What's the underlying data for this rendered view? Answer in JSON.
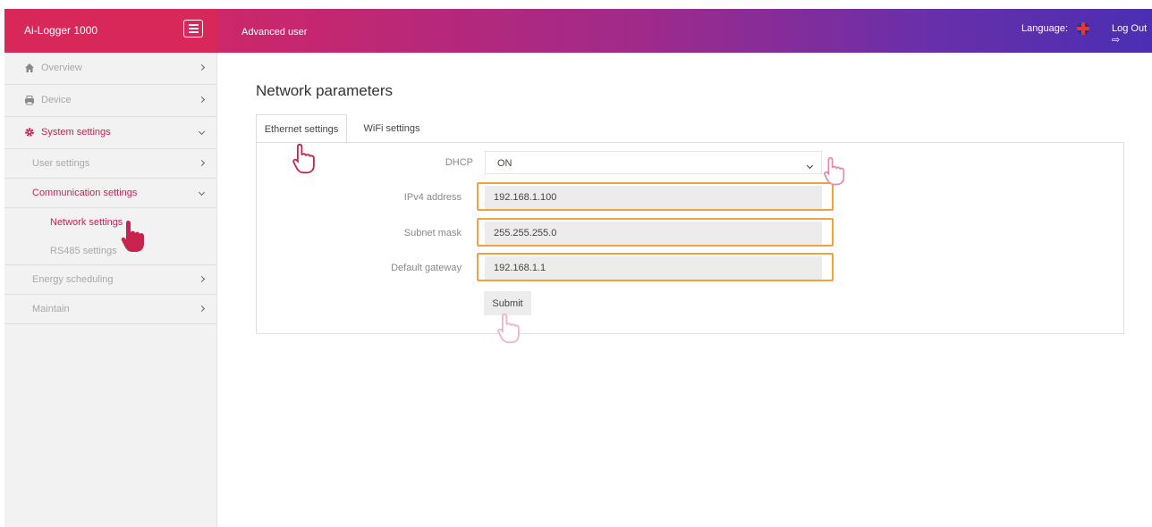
{
  "header": {
    "brand": "Ai-Logger 1000",
    "user_role": "Advanced user",
    "language_label": "Language:",
    "logout": "Log Out"
  },
  "sidebar": {
    "items": [
      {
        "label": "Overview",
        "icon": "home-icon"
      },
      {
        "label": "Device",
        "icon": "printer-icon"
      },
      {
        "label": "System settings",
        "icon": "gear-icon"
      }
    ],
    "system_children": [
      {
        "label": "User settings"
      },
      {
        "label": "Communication settings"
      }
    ],
    "communication_children": [
      {
        "label": "Network settings"
      },
      {
        "label": "RS485 settings"
      }
    ],
    "more_items": [
      {
        "label": "Energy scheduling"
      },
      {
        "label": "Maintain"
      }
    ]
  },
  "main": {
    "title": "Network parameters",
    "tabs": [
      {
        "label": "Ethernet settings",
        "active": true
      },
      {
        "label": "WiFi settings",
        "active": false
      }
    ],
    "form": {
      "dhcp_label": "DHCP",
      "dhcp_value": "ON",
      "ipv4_label": "IPv4 address",
      "ipv4_value": "192.168.1.100",
      "subnet_label": "Subnet mask",
      "subnet_value": "255.255.255.0",
      "gateway_label": "Default gateway",
      "gateway_value": "192.168.1.1",
      "submit_label": "Submit"
    }
  },
  "colors": {
    "accent": "#c8234f",
    "highlight": "#f0a243"
  }
}
